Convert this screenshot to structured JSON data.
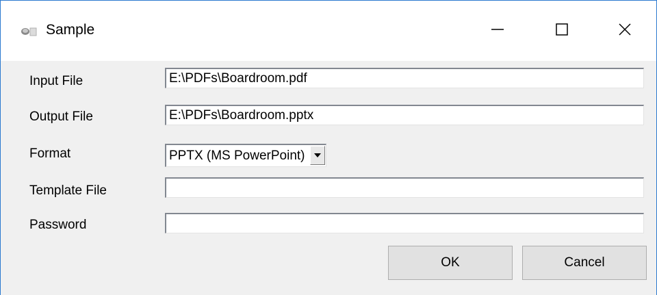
{
  "window": {
    "title": "Sample",
    "accent_color": "#2b79d0",
    "controls": {
      "minimize_icon": "minimize-icon",
      "maximize_icon": "maximize-icon",
      "close_icon": "close-icon"
    }
  },
  "form": {
    "input_file": {
      "label": "Input File",
      "value": "E:\\PDFs\\Boardroom.pdf"
    },
    "output_file": {
      "label": "Output File",
      "value": "E:\\PDFs\\Boardroom.pptx"
    },
    "format": {
      "label": "Format",
      "selected": "PPTX (MS PowerPoint)"
    },
    "template_file": {
      "label": "Template File",
      "value": ""
    },
    "password": {
      "label": "Password",
      "value": ""
    }
  },
  "buttons": {
    "ok_label": "OK",
    "cancel_label": "Cancel"
  }
}
